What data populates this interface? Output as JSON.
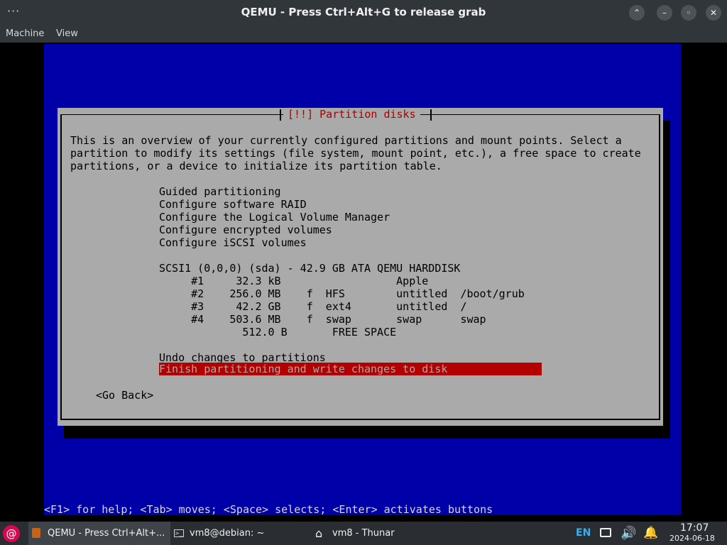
{
  "window": {
    "title": "QEMU - Press Ctrl+Alt+G to release grab",
    "menu_dots": "···",
    "min_icon": "chevron-up-icon",
    "btn_min": "⌃",
    "btn_restore": "–",
    "btn_max": "◦",
    "btn_close": "✕"
  },
  "menubar": {
    "items": [
      "Machine",
      "View"
    ]
  },
  "installer": {
    "dialog_title": "[!!] Partition disks",
    "description": [
      "This is an overview of your currently configured partitions and mount points. Select a",
      "partition to modify its settings (file system, mount point, etc.), a free space to create",
      "partitions, or a device to initialize its partition table."
    ],
    "options": [
      "Guided partitioning",
      "Configure software RAID",
      "Configure the Logical Volume Manager",
      "Configure encrypted volumes",
      "Configure iSCSI volumes"
    ],
    "disk": "SCSI1 (0,0,0) (sda) - 42.9 GB ATA QEMU HARDDISK",
    "partitions": [
      "     #1     32.3 kB                  Apple",
      "     #2    256.0 MB    f  HFS        untitled  /boot/grub",
      "     #3     42.2 GB    f  ext4       untitled  /",
      "     #4    503.6 MB    f  swap       swap      swap",
      "             512.0 B       FREE SPACE"
    ],
    "undo": "Undo changes to partitions",
    "finish": "Finish partitioning and write changes to disk",
    "go_back": "<Go Back>",
    "help_line": "<F1> for help; <Tab> moves; <Space> selects; <Enter> activates buttons"
  },
  "taskbar": {
    "items": [
      {
        "label": "QEMU - Press Ctrl+Alt+...",
        "icon": "qemu-icon"
      },
      {
        "label": "vm8@debian: ~",
        "icon": "terminal-icon"
      },
      {
        "label": "vm8 - Thunar",
        "icon": "home-folder-icon"
      }
    ],
    "language": "EN",
    "time": "17:07",
    "date": "2024-06-18"
  },
  "colors": {
    "vm_background": "#0000a8",
    "dialog_background": "#aaaaaa",
    "selection": "#b30000",
    "title_red": "#a80000"
  }
}
